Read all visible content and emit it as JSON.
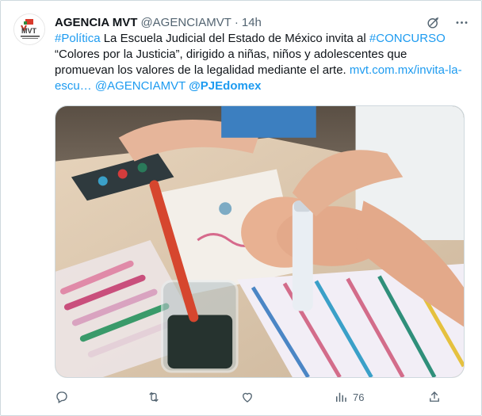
{
  "author": {
    "name": "AGENCIA MVT",
    "handle": "@AGENCIAMVT",
    "separator": "·",
    "time": "14h",
    "avatar_text": "MVT",
    "avatar_subtext": "Agencia de Noticias"
  },
  "tweet": {
    "hashtag1": "#Política",
    "text1": " La Escuela Judicial del Estado de México invita al ",
    "hashtag2": "#CONCURSO",
    "text2": " “Colores por la Justicia”, dirigido a niñas, niños y adolescentes que promuevan los valores de la legalidad mediante el arte. ",
    "url": "mvt.com.mx/invita-la-escu…",
    "space": " ",
    "mention1": "@AGENCIAMVT",
    "mention2": "@PJEdomex"
  },
  "actions": {
    "views_count": "76"
  },
  "icons": {
    "grok": "grok-icon",
    "more": "more-icon",
    "reply": "reply-icon",
    "retweet": "retweet-icon",
    "like": "like-icon",
    "views": "views-icon",
    "share": "share-icon"
  },
  "colors": {
    "link": "#1d9bf0",
    "muted": "#536471",
    "text": "#0f1419",
    "border": "#cfd9de"
  }
}
